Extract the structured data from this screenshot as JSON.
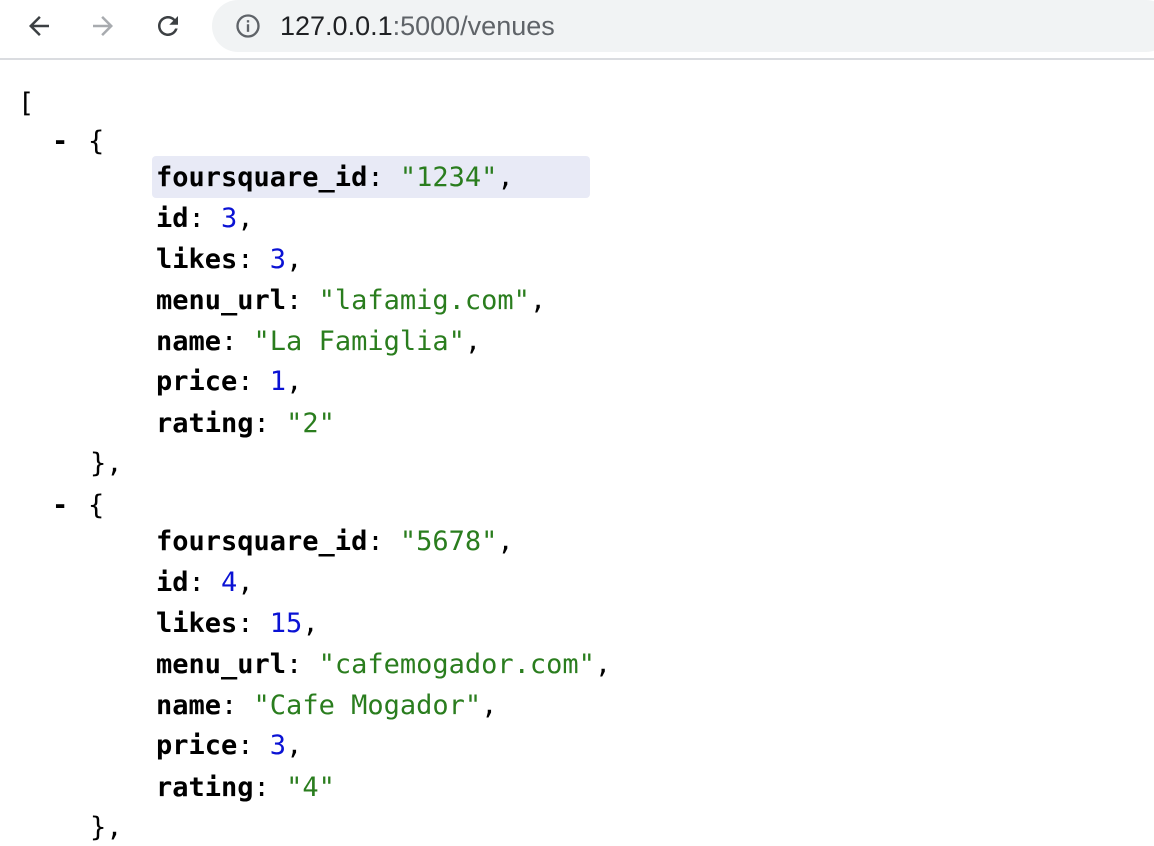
{
  "browser": {
    "url_host": "127.0.0.1",
    "url_path": ":5000/venues",
    "icons": {
      "back": "arrow-left-icon",
      "forward": "arrow-right-icon",
      "reload": "reload-icon",
      "info": "info-circle-icon"
    }
  },
  "json_viewer": {
    "open_bracket": "[",
    "collapse_symbol": "-",
    "venues": [
      {
        "foursquare_id": "\"1234\"",
        "id": "3",
        "likes": "3",
        "menu_url": "\"lafamig.com\"",
        "name": "\"La Famiglia\"",
        "price": "1",
        "rating": "\"2\""
      },
      {
        "foursquare_id": "\"5678\"",
        "id": "4",
        "likes": "15",
        "menu_url": "\"cafemogador.com\"",
        "name": "\"Cafe Mogador\"",
        "price": "3",
        "rating": "\"4\""
      }
    ]
  }
}
